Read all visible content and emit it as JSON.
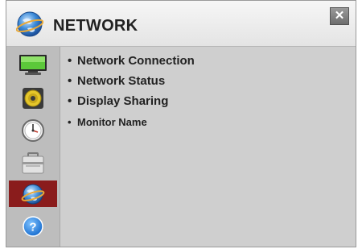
{
  "header": {
    "title": "NETWORK",
    "close_label": "✕"
  },
  "sidebar": {
    "items": [
      {
        "name": "picture",
        "icon": "tv-icon"
      },
      {
        "name": "sound",
        "icon": "speaker-icon"
      },
      {
        "name": "time",
        "icon": "clock-icon"
      },
      {
        "name": "setup",
        "icon": "toolbox-icon"
      },
      {
        "name": "network",
        "icon": "globe-icon",
        "active": true
      },
      {
        "name": "support",
        "icon": "help-icon"
      }
    ]
  },
  "menu": {
    "items": [
      {
        "bullet": "•",
        "label": "Network Connection"
      },
      {
        "bullet": "•",
        "label": "Network Status"
      },
      {
        "bullet": "•",
        "label": "Display Sharing"
      },
      {
        "bullet": "•",
        "label": "Monitor Name"
      }
    ]
  },
  "colors": {
    "active_item": "#8a1c1c",
    "panel": "#cfcfcf",
    "sidebar": "#bdbdbd"
  }
}
